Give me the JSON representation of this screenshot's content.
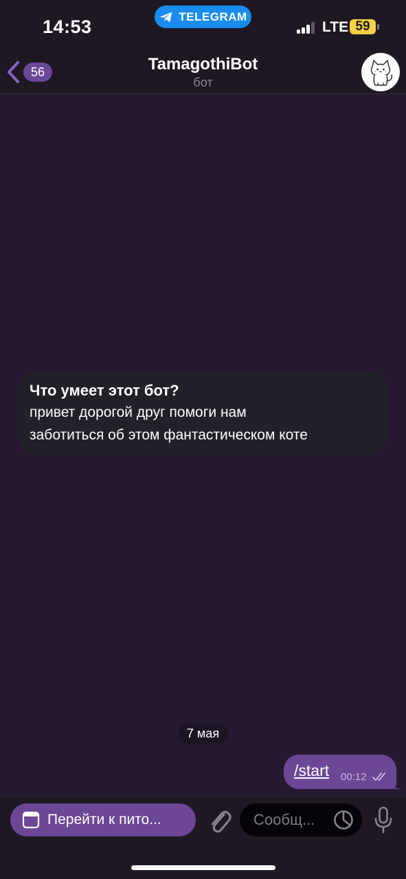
{
  "status_bar": {
    "time": "14:53",
    "app_pill": "TELEGRAM",
    "network": "LTE",
    "battery": "59"
  },
  "header": {
    "back_count": "56",
    "title": "TamagothiBot",
    "subtitle": "бот",
    "avatar_icon": "cat-avatar-icon"
  },
  "bot_info": {
    "title": "Что умеет этот бот?",
    "line1": "привет дорогой друг помоги нам",
    "line2": "заботиться об этом фантастическом коте"
  },
  "messages": {
    "date": "7 мая",
    "outgoing": {
      "text": "/start",
      "time": "00:12",
      "status": "read"
    }
  },
  "input_bar": {
    "app_button_label": "Перейти к пито...",
    "placeholder": "Сообщ...",
    "icons": [
      "web-app-icon",
      "paperclip-icon",
      "sticker-icon",
      "microphone-icon"
    ]
  },
  "colors": {
    "chat_background": "#261a31",
    "header_background": "#1e1823",
    "accent": "#6c4796",
    "telegram_blue": "#1a8cf0",
    "battery": "#f6d145"
  }
}
